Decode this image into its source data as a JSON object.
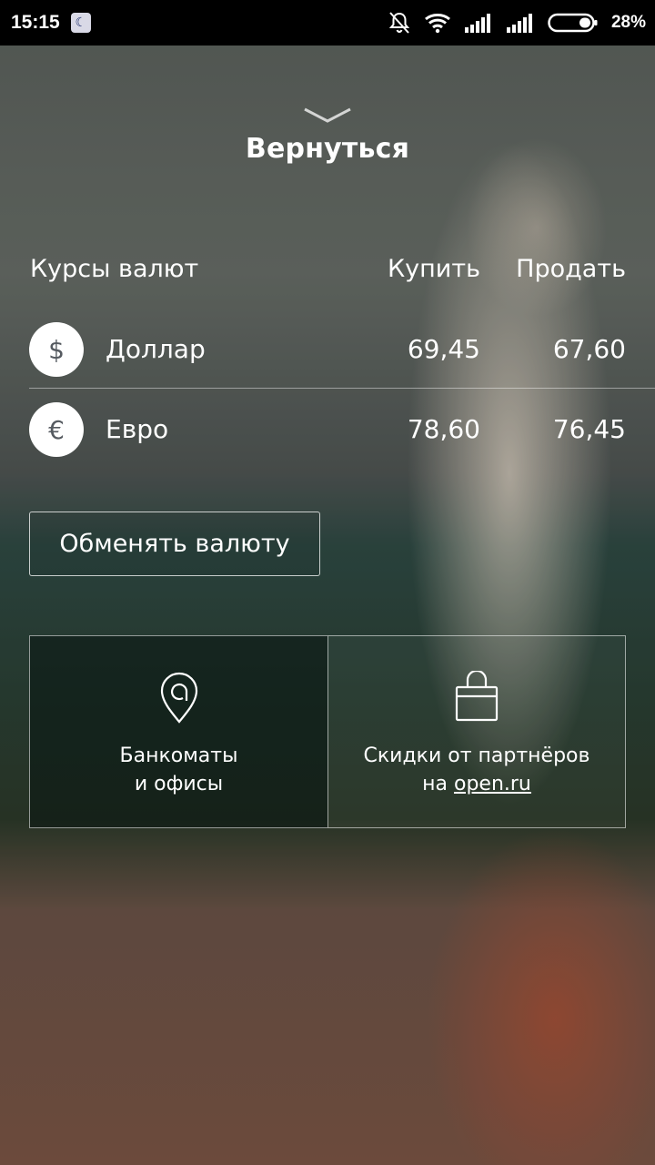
{
  "status_bar": {
    "time": "15:15",
    "battery": "28%"
  },
  "back": {
    "label": "Вернуться"
  },
  "rates": {
    "title": "Курсы валют",
    "buy_header": "Купить",
    "sell_header": "Продать",
    "rows": [
      {
        "symbol": "$",
        "name": "Доллар",
        "buy": "69,45",
        "sell": "67,60"
      },
      {
        "symbol": "€",
        "name": "Евро",
        "buy": "78,60",
        "sell": "76,45"
      }
    ]
  },
  "exchange_button": {
    "label": "Обменять валюту"
  },
  "tiles": {
    "atm": {
      "line1": "Банкоматы",
      "line2": "и офисы",
      "icon": "map-pin-icon"
    },
    "discounts": {
      "line1": "Скидки от партнёров",
      "line2_prefix": "на ",
      "link": "open.ru",
      "icon": "shopping-bag-icon"
    }
  }
}
